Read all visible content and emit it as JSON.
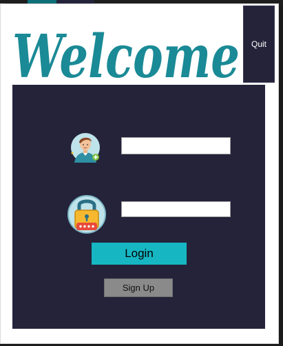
{
  "banner": {
    "welcome_text": "Welcome"
  },
  "quit": {
    "label": "Quit"
  },
  "form": {
    "username_value": "",
    "password_value": ""
  },
  "login": {
    "label": "Login"
  },
  "signup": {
    "label": "Sign Up"
  },
  "colors": {
    "accent": "#16b6c3",
    "welcome_teal": "#1a8a96",
    "panel_dark": "#24233a",
    "signup_gray": "#8a8a8a"
  },
  "icons": {
    "user": "user-avatar-icon",
    "lock": "padlock-password-icon"
  }
}
